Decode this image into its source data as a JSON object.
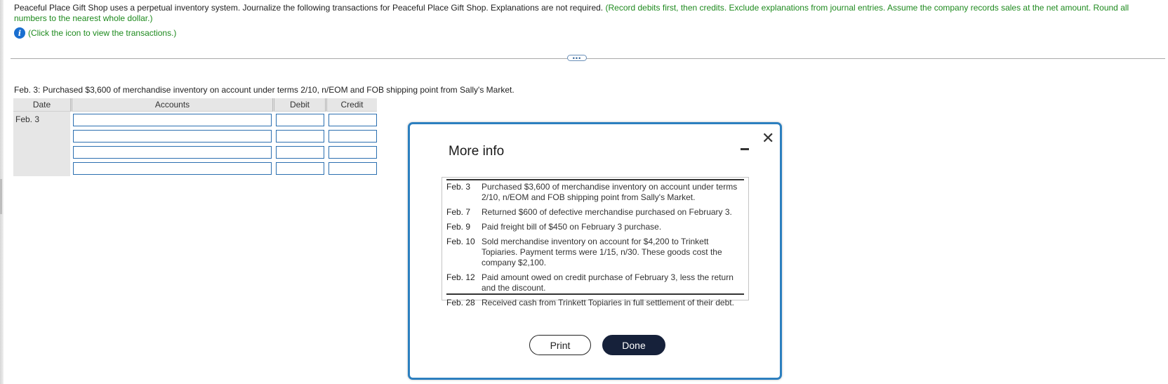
{
  "question": {
    "text": "Peaceful Place Gift Shop uses a perpetual inventory system. Journalize the following transactions for Peaceful Place Gift Shop. Explanations are not required.",
    "instructions": "(Record debits first, then credits. Exclude explanations from journal entries. Assume the company records sales at the net amount. Round all numbers to the nearest whole dollar.)"
  },
  "info_link": {
    "icon": "info-icon",
    "text": "(Click the icon to view the transactions.)"
  },
  "expand_handle": "•••",
  "prompt": "Feb. 3: Purchased $3,600 of merchandise inventory on account under terms 2/10, n/EOM and FOB shipping point from Sally's Market.",
  "journal": {
    "headers": {
      "date": "Date",
      "accounts": "Accounts",
      "debit": "Debit",
      "credit": "Credit"
    },
    "date": "Feb. 3",
    "rows": [
      {
        "account": "",
        "debit": "",
        "credit": ""
      },
      {
        "account": "",
        "debit": "",
        "credit": ""
      },
      {
        "account": "",
        "debit": "",
        "credit": ""
      },
      {
        "account": "",
        "debit": "",
        "credit": ""
      }
    ]
  },
  "modal": {
    "title": "More info",
    "minimize_icon": "minimize-icon",
    "close_icon": "close-icon",
    "close_glyph": "✕",
    "transactions": [
      {
        "date": "Feb. 3",
        "text": "Purchased $3,600 of merchandise inventory on account under terms 2/10, n/EOM and FOB shipping point from Sally's Market."
      },
      {
        "date": "Feb. 7",
        "text": "Returned $600 of defective merchandise purchased on February 3."
      },
      {
        "date": "Feb. 9",
        "text": "Paid freight bill of $450 on February 3 purchase."
      },
      {
        "date": "Feb. 10",
        "text": "Sold merchandise inventory on account for $4,200 to Trinkett Topiaries. Payment terms were 1/15, n/30. These goods cost the company $2,100."
      },
      {
        "date": "Feb. 12",
        "text": "Paid amount owed on credit purchase of February 3, less the return and the discount."
      },
      {
        "date": "Feb. 28",
        "text": "Received cash from Trinkett Topiaries in full settlement of their debt."
      }
    ],
    "print_label": "Print",
    "done_label": "Done"
  },
  "colors": {
    "instruction_green": "#1e8a1e",
    "input_border_blue": "#2b6fb0",
    "modal_border": "#2c7fbf",
    "done_button": "#16213a"
  }
}
